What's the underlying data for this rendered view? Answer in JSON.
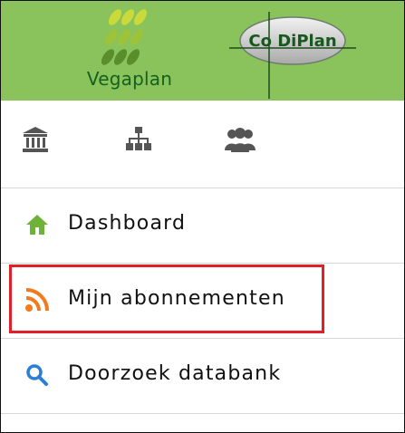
{
  "header": {
    "logo_left_text": "Vegaplan",
    "logo_right_text": "Co DiPlan",
    "background_color": "#8ac25b"
  },
  "top_icons": [
    {
      "name": "bank-icon"
    },
    {
      "name": "sitemap-icon"
    },
    {
      "name": "users-icon"
    }
  ],
  "menu": {
    "items": [
      {
        "label": "Dashboard",
        "icon": "home-icon"
      },
      {
        "label": "Mijn abonnementen",
        "icon": "rss-icon",
        "highlighted": true
      },
      {
        "label": "Doorzoek databank",
        "icon": "search-icon"
      }
    ]
  },
  "colors": {
    "highlight": "#e11f2a",
    "home_icon": "#6fb23a",
    "rss_icon": "#f37b1d",
    "search_icon": "#2a7fd4",
    "nav_icon": "#555555"
  }
}
